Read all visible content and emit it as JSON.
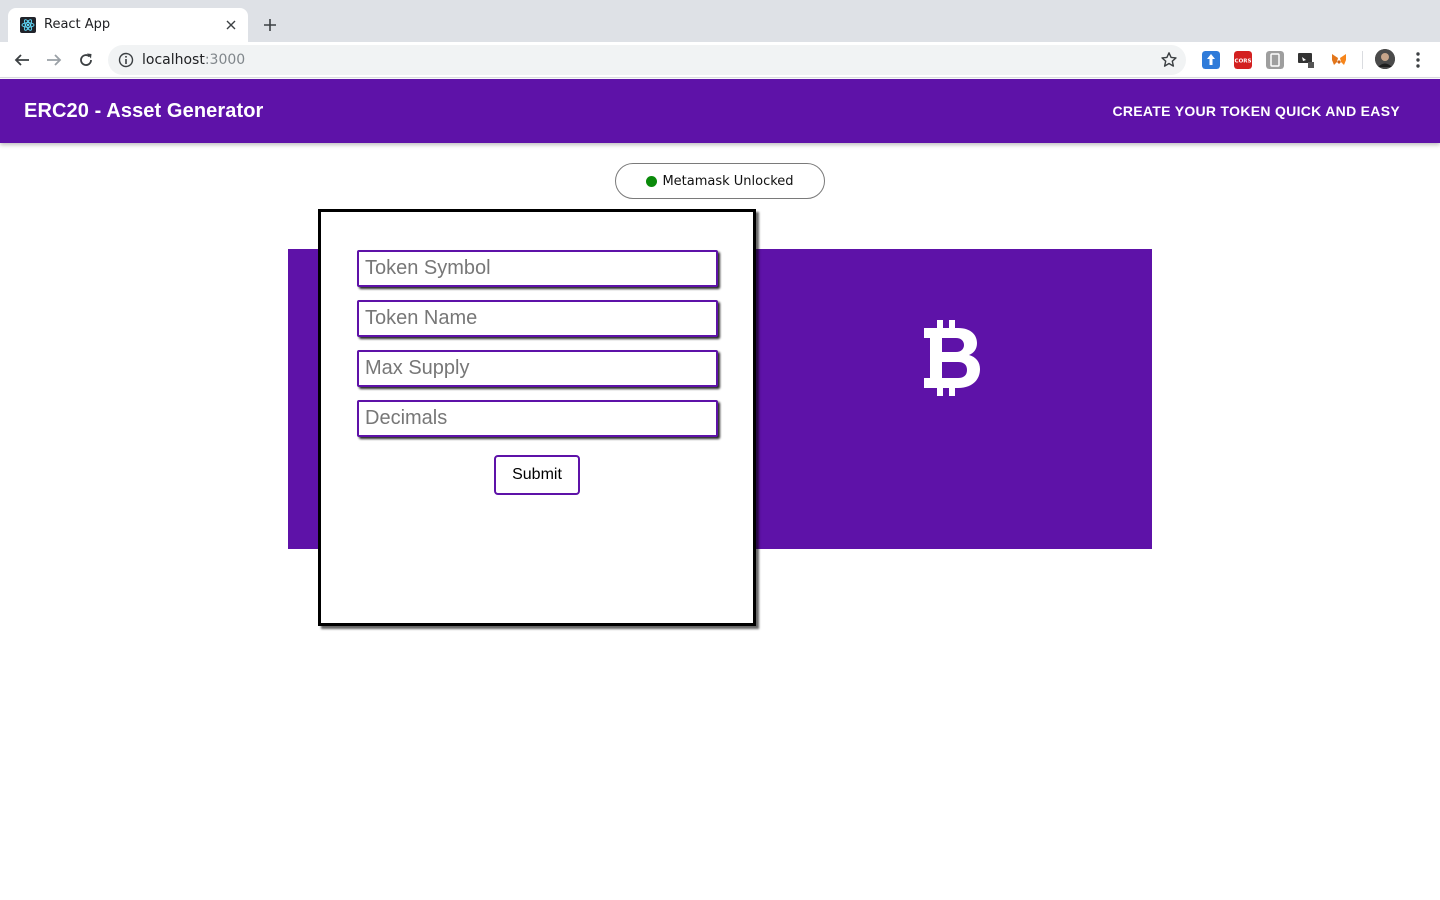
{
  "browser": {
    "tab_title": "React App",
    "url_host": "localhost",
    "url_port": ":3000",
    "favicon": "react-icon",
    "extensions": [
      "upload-ext-icon",
      "cors-ext-icon",
      "grey-ext-icon",
      "screen-ext-icon",
      "metamask-fox-icon"
    ]
  },
  "app": {
    "title": "ERC20 - Asset Generator",
    "tagline": "CREATE YOUR TOKEN QUICK AND EASY",
    "accent_color": "#5e12a8"
  },
  "status": {
    "text": "Metamask Unlocked",
    "color": "#0a8a0a"
  },
  "form": {
    "fields": [
      {
        "placeholder": "Token Symbol",
        "value": ""
      },
      {
        "placeholder": "Token Name",
        "value": ""
      },
      {
        "placeholder": "Max Supply",
        "value": ""
      },
      {
        "placeholder": "Decimals",
        "value": ""
      }
    ],
    "submit_label": "Submit"
  },
  "banner": {
    "icon": "bitcoin-icon"
  }
}
